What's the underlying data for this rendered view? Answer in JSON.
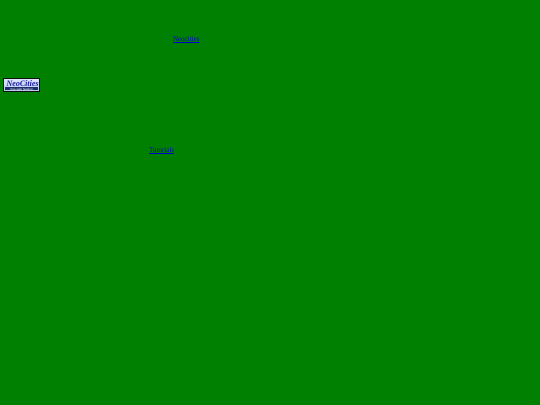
{
  "page": {
    "background_color": "#008000",
    "link_color": "#0000cc"
  },
  "links": {
    "top_label": "Neocities",
    "middle_label": "Tutorials"
  },
  "badge": {
    "title": "NeoCities",
    "subtitle": "free web hosting",
    "icon": "neocities-badge-icon"
  }
}
